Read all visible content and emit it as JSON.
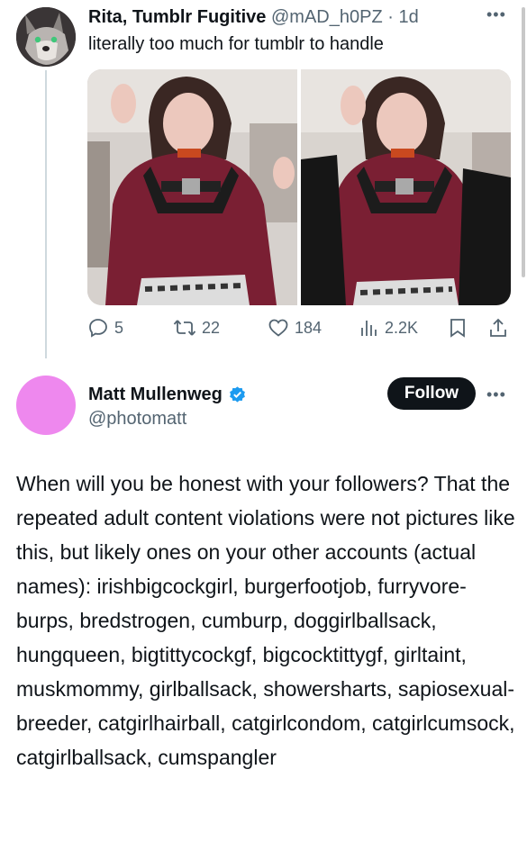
{
  "tweet1": {
    "author_name": "Rita, Tumblr Fugitive",
    "handle": "@mAD_h0PZ",
    "separator": "·",
    "time": "1d",
    "text": "literally too much for tumblr to handle",
    "stats": {
      "replies": "5",
      "retweets": "22",
      "likes": "184",
      "views": "2.2K"
    }
  },
  "tweet2": {
    "author_name": "Matt Mullenweg",
    "handle": "@photomatt",
    "follow_label": "Follow",
    "avatar_color": "#ee88ee",
    "body": "When will you be honest with your followers? That the repeated adult content violations were not pictures like this, but likely ones on your other accounts (actual names): irishbigcockgirl, burgerfootjob, furryvore-burps, bredstrogen, cumburp, doggirlballsack, hungqueen, bigtittycockgf, bigcocktittygf, girltaint, muskmommy, girlballsack, showersharts, sapiosexual-breeder, catgirlhairball, catgirlcondom, catgirlcumsock, catgirlballsack, cumspangler"
  },
  "colors": {
    "text": "#0f1419",
    "muted": "#536471",
    "verified": "#1d9bf0",
    "follow_bg": "#0f1419"
  }
}
